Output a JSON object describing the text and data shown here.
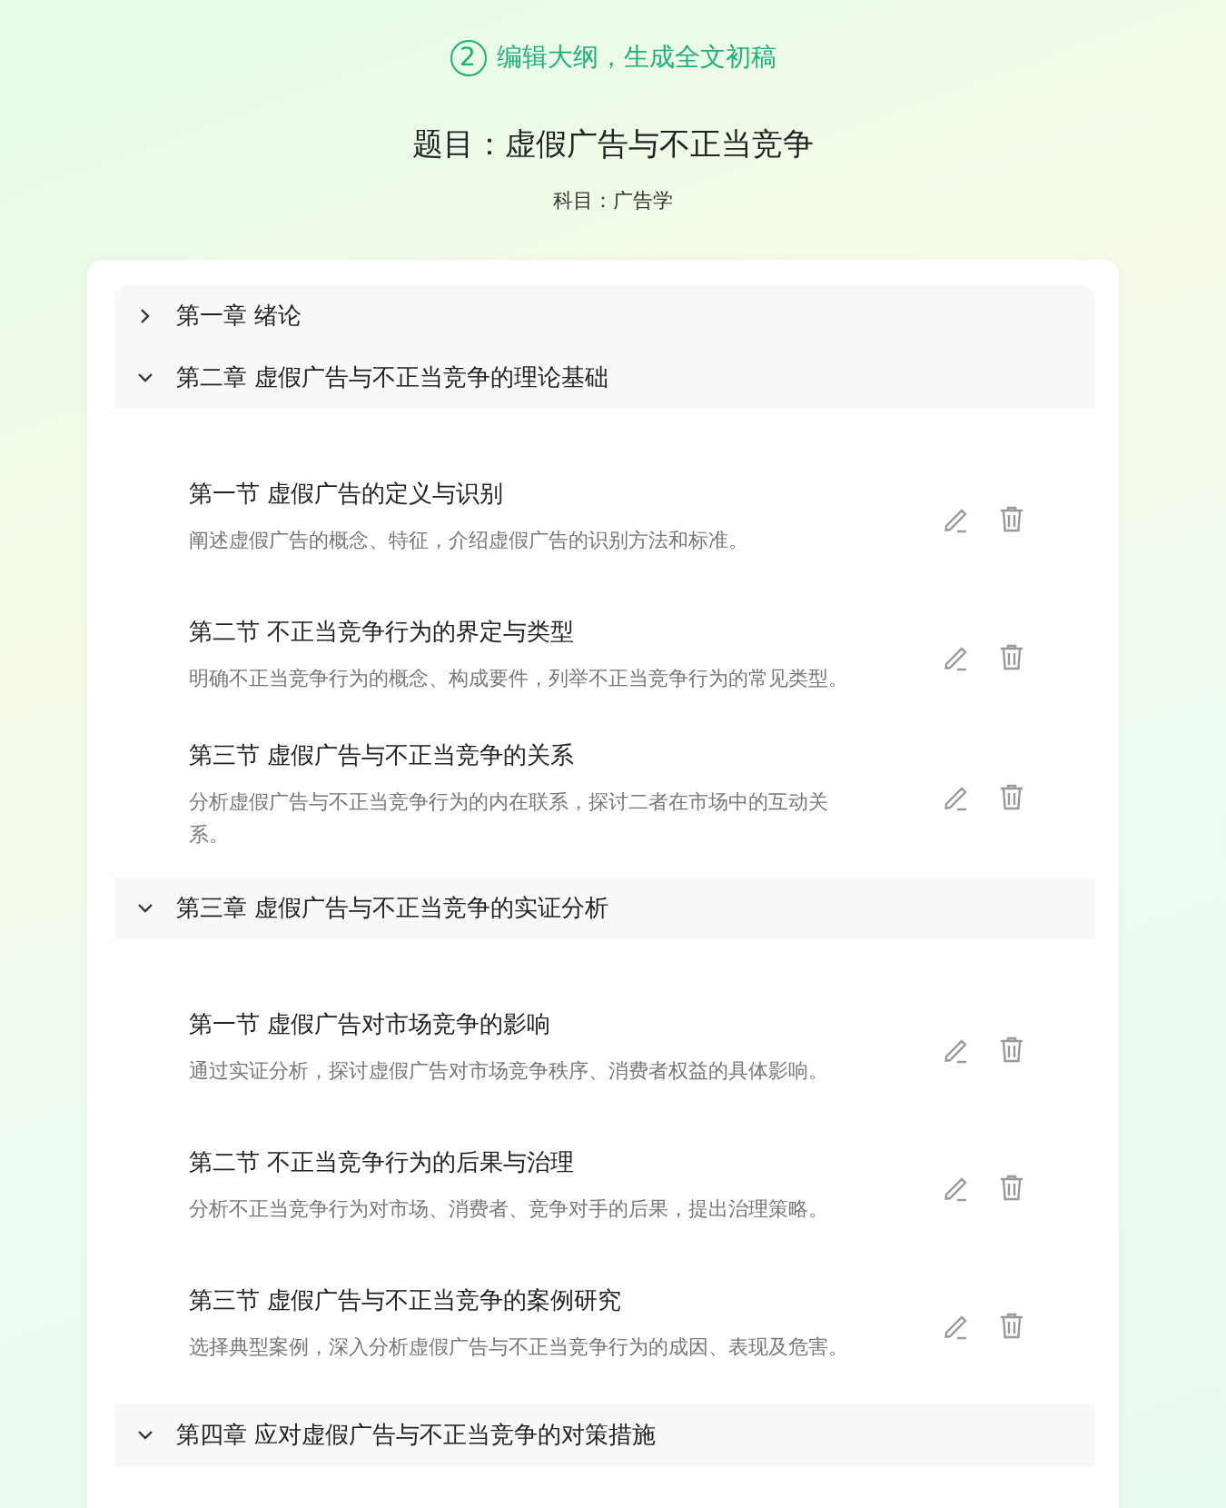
{
  "step": {
    "number": "2",
    "label": "编辑大纲，生成全文初稿"
  },
  "title": "题目：虚假广告与不正当竞争",
  "subject": "科目：广告学",
  "chapters": [
    {
      "title": "第一章 绪论",
      "expanded": false
    },
    {
      "title": "第二章 虚假广告与不正当竞争的理论基础",
      "expanded": true,
      "sections": [
        {
          "title": "第一节 虚假广告的定义与识别",
          "description": "阐述虚假广告的概念、特征，介绍虚假广告的识别方法和标准。"
        },
        {
          "title": "第二节 不正当竞争行为的界定与类型",
          "description": "明确不正当竞争行为的概念、构成要件，列举不正当竞争行为的常见类型。"
        },
        {
          "title": "第三节 虚假广告与不正当竞争的关系",
          "description": "分析虚假广告与不正当竞争行为的内在联系，探讨二者在市场中的互动关系。"
        }
      ]
    },
    {
      "title": "第三章 虚假广告与不正当竞争的实证分析",
      "expanded": true,
      "sections": [
        {
          "title": "第一节 虚假广告对市场竞争的影响",
          "description": "通过实证分析，探讨虚假广告对市场竞争秩序、消费者权益的具体影响。"
        },
        {
          "title": "第二节 不正当竞争行为的后果与治理",
          "description": "分析不正当竞争行为对市场、消费者、竞争对手的后果，提出治理策略。"
        },
        {
          "title": "第三节 虚假广告与不正当竞争的案例研究",
          "description": "选择典型案例，深入分析虚假广告与不正当竞争行为的成因、表现及危害。"
        }
      ]
    },
    {
      "title": "第四章 应对虚假广告与不正当竞争的对策措施",
      "expanded": true
    }
  ]
}
